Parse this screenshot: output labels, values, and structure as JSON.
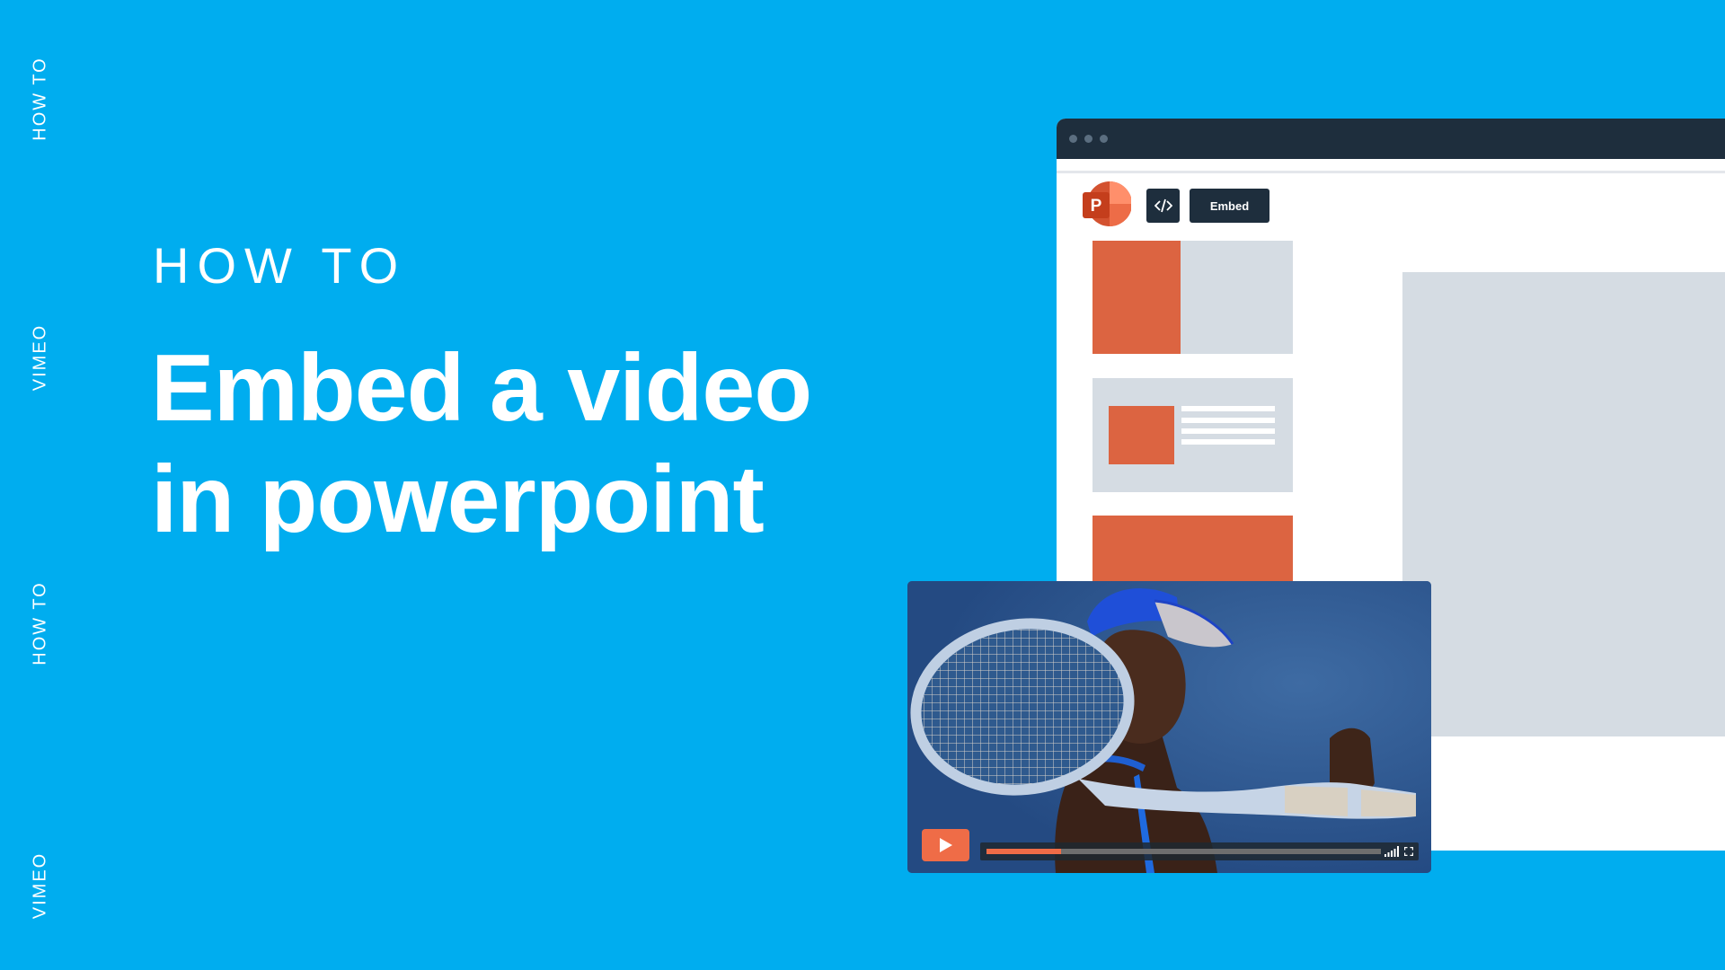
{
  "side_labels": {
    "top_how_to": "HOW TO",
    "top_vimeo": "VIMEO",
    "bottom_how_to": "HOW TO",
    "bottom_vimeo": "VIMEO"
  },
  "hero": {
    "kicker": "HOW TO",
    "headline_line1": "Embed a video",
    "headline_line2": "in powerpoint"
  },
  "browser_mock": {
    "app_icon": "powerpoint-logo-icon",
    "app_icon_letter": "P",
    "code_button_icon": "code-icon",
    "code_button_glyph": "</>",
    "embed_button_label": "Embed",
    "slide_thumbnails": 3
  },
  "video_player": {
    "play_icon": "play-icon",
    "progress": 0.19,
    "volume_icon": "volume-bars-icon",
    "fullscreen_icon": "fullscreen-icon"
  },
  "colors": {
    "background": "#00ADEF",
    "dark": "#1E2E3D",
    "accent_orange": "#DC6441",
    "play_orange": "#EF6C47",
    "placeholder_grey": "#D5DCE3",
    "text": "#FFFFFF"
  }
}
